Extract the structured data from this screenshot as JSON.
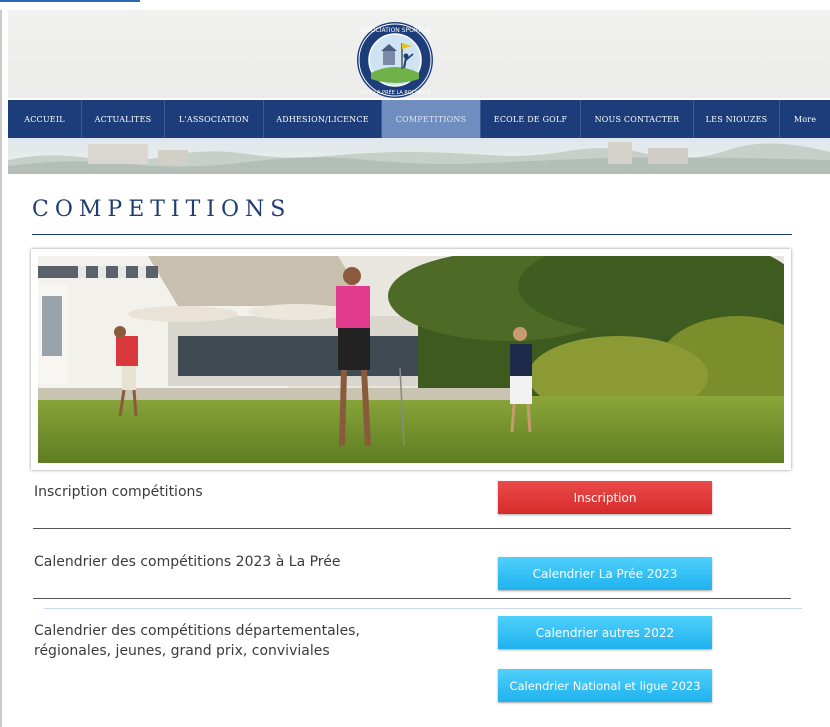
{
  "logo": {
    "text_top": "ASSOCIATION SPORTIVE",
    "text_bottom": "GOLF LA PRÉE LA ROCHELLE"
  },
  "nav": {
    "items": [
      {
        "label": "ACCUEIL",
        "active": false
      },
      {
        "label": "ACTUALITES",
        "active": false
      },
      {
        "label": "L'ASSOCIATION",
        "active": false
      },
      {
        "label": "ADHESION/LICENCE",
        "active": false
      },
      {
        "label": "COMPETITIONS",
        "active": true
      },
      {
        "label": "ECOLE DE GOLF",
        "active": false
      },
      {
        "label": "NOUS CONTACTER",
        "active": false
      },
      {
        "label": "LES NIOUZES",
        "active": false
      },
      {
        "label": "More",
        "active": false
      }
    ]
  },
  "page": {
    "title": "COMPETITIONS"
  },
  "sections": {
    "inscription": {
      "label": "Inscription compétitions",
      "button": "Inscription"
    },
    "calendar_lapree": {
      "label": "Calendrier des compétitions  2023 à La Prée",
      "button": "Calendrier La Prée 2023"
    },
    "calendar_other": {
      "label_line1": "Calendrier des compétitions  départementales,",
      "label_line2": "régionales, jeunes, grand prix, conviviales",
      "button_other": "Calendrier autres 2022",
      "button_national": "Calendrier National et ligue 2023"
    }
  },
  "colors": {
    "nav_bg": "#1d3d7a",
    "nav_active": "#6f8dbf",
    "title": "#1f3d73",
    "btn_red": "#e03838",
    "btn_blue": "#2dbdf3"
  },
  "icons": {
    "logo": "golf-club-crest-logo"
  }
}
